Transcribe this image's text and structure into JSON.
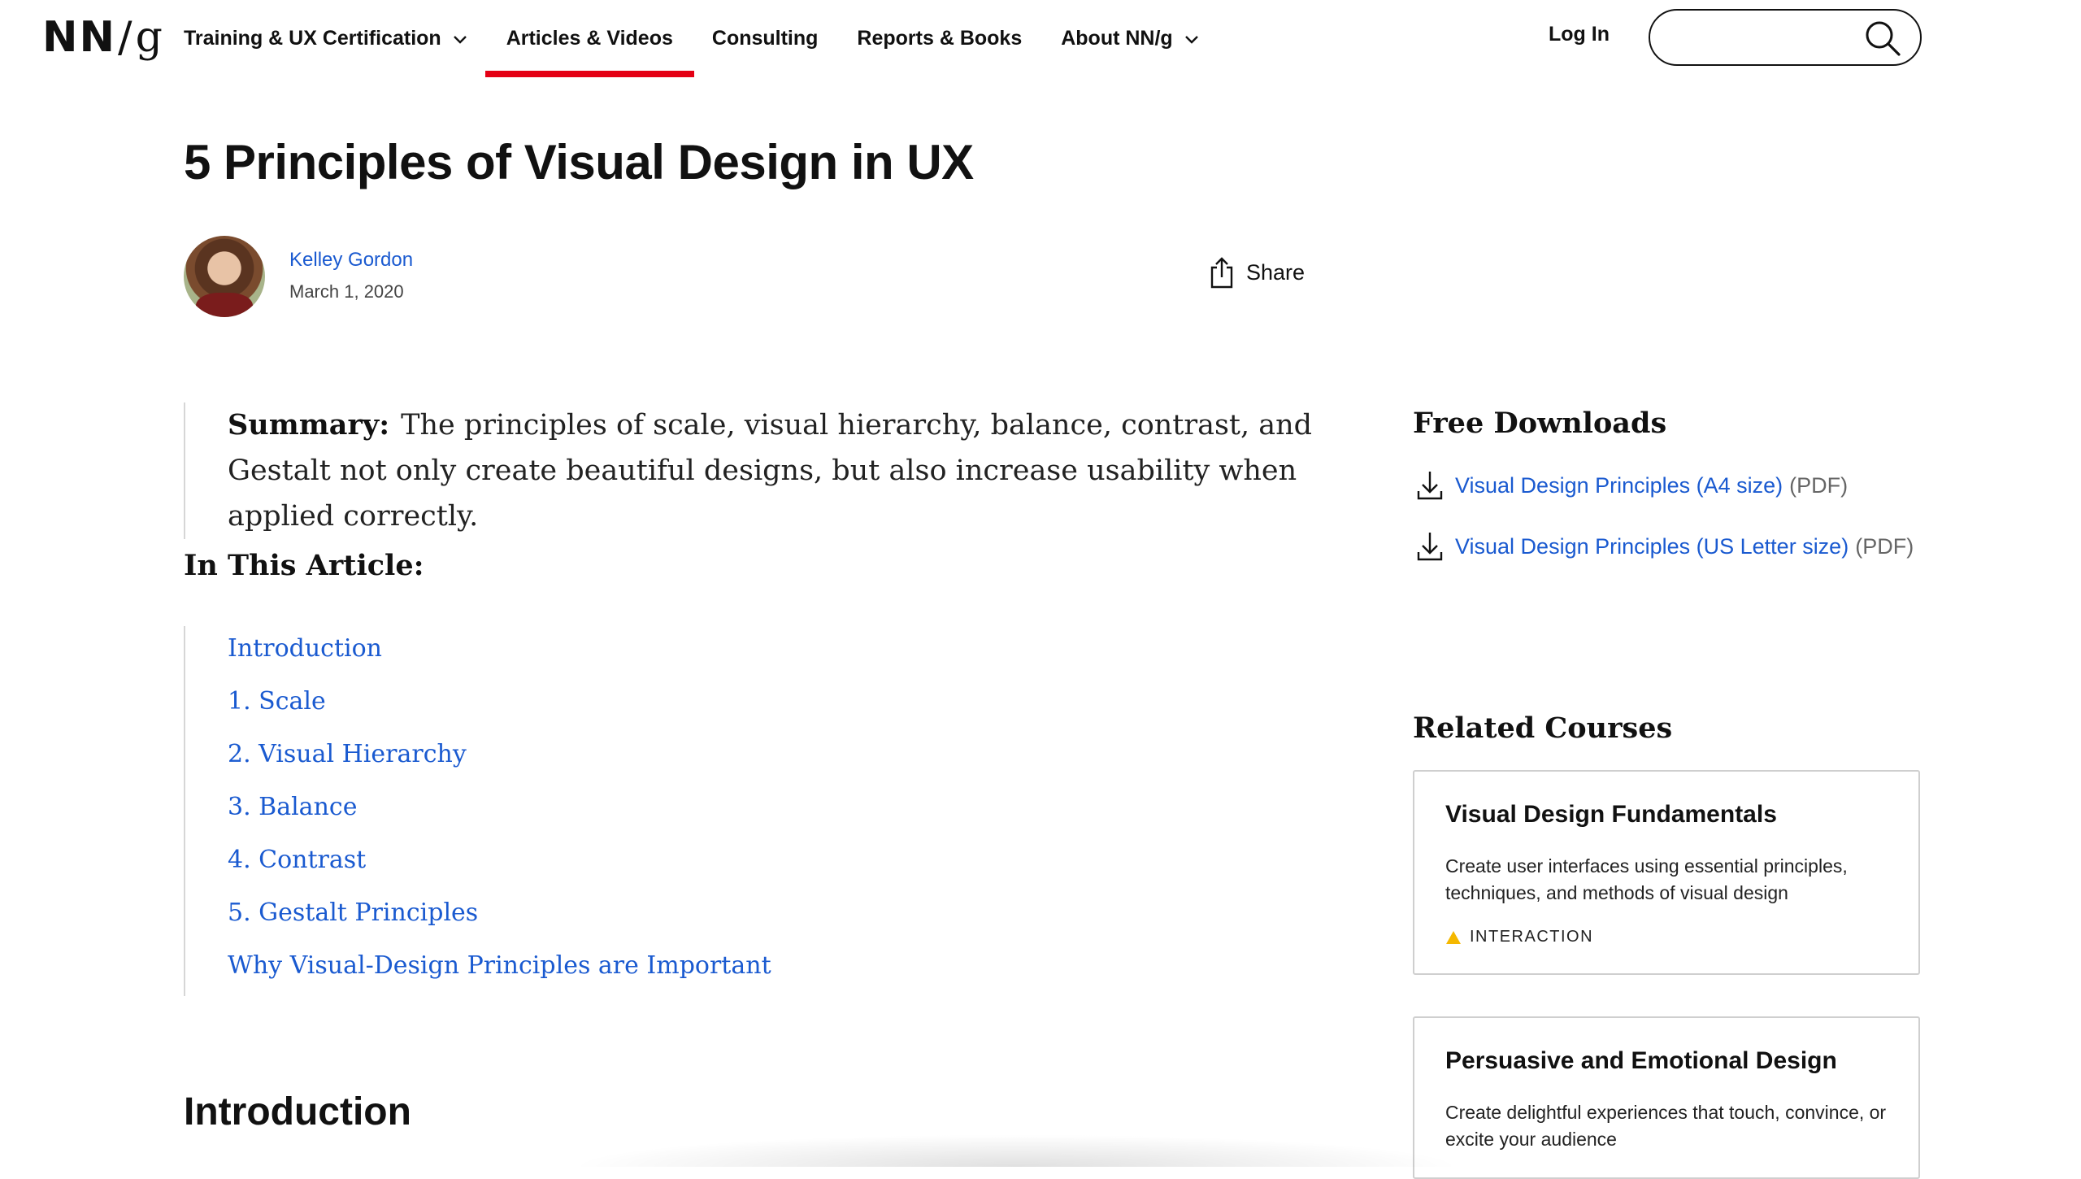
{
  "header": {
    "logo": {
      "nn": "NN",
      "slash": "/",
      "g": "g"
    },
    "nav": [
      {
        "label": "Training & UX Certification",
        "has_dropdown": true,
        "active": false
      },
      {
        "label": "Articles & Videos",
        "has_dropdown": false,
        "active": true
      },
      {
        "label": "Consulting",
        "has_dropdown": false,
        "active": false
      },
      {
        "label": "Reports & Books",
        "has_dropdown": false,
        "active": false
      },
      {
        "label": "About NN/g",
        "has_dropdown": true,
        "active": false
      }
    ],
    "login_label": "Log In",
    "search": {
      "placeholder": "",
      "icon": "search-icon"
    },
    "active_color": "#e40014"
  },
  "article": {
    "title": "5 Principles of Visual Design in UX",
    "author": "Kelley Gordon",
    "date": "March 1, 2020",
    "share_label": "Share",
    "summary_label": "Summary:",
    "summary_text": "The principles of scale, visual hierarchy, balance, contrast, and Gestalt not only create beautiful designs, but also increase usability when applied correctly.",
    "toc_heading": "In This Article:",
    "toc": [
      "Introduction",
      "1. Scale",
      "2. Visual Hierarchy",
      "3. Balance",
      "4. Contrast",
      "5. Gestalt Principles",
      "Why Visual-Design Principles are Important"
    ],
    "intro_heading": "Introduction"
  },
  "sidebar": {
    "downloads_title": "Free Downloads",
    "downloads": [
      {
        "label": "Visual Design Principles (A4 size)",
        "format": "(PDF)"
      },
      {
        "label": "Visual Design Principles (US Letter size)",
        "format": "(PDF)"
      }
    ],
    "related_title": "Related Courses",
    "courses": [
      {
        "title": "Visual Design Fundamentals",
        "description": "Create user interfaces using essential principles, techniques, and methods of visual design",
        "tag": "INTERACTION"
      },
      {
        "title": "Persuasive and Emotional Design",
        "description": "Create delightful experiences that touch, convince, or excite your audience"
      }
    ]
  },
  "colors": {
    "link": "#1a5ad0",
    "accent_red": "#e40014",
    "tag_yellow": "#f5b800"
  }
}
